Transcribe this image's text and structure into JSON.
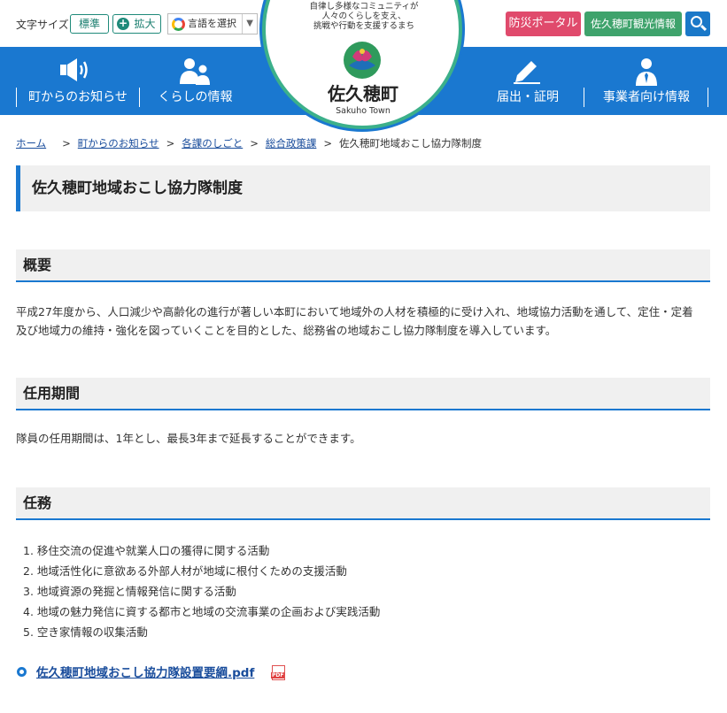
{
  "utility": {
    "font_size_label": "文字サイズ",
    "font_standard": "標準",
    "font_large": "拡大",
    "language_select": "言語を選択",
    "disaster_portal": "防災ポータル",
    "tourism_info": "佐久穂町観光情報"
  },
  "logo": {
    "tagline_1": "自律し多様なコミュニティが",
    "tagline_2": "人々のくらしを支え、",
    "tagline_3": "挑戦や行動を支援するまち",
    "name": "佐久穂町",
    "sub": "Sakuho Town"
  },
  "nav": {
    "items": [
      {
        "label": "町からのお知らせ",
        "icon": "megaphone-icon"
      },
      {
        "label": "くらしの情報",
        "icon": "people-icon"
      },
      {
        "label": "届出・証明",
        "icon": "pen-icon"
      },
      {
        "label": "事業者向け情報",
        "icon": "businessperson-icon"
      }
    ]
  },
  "breadcrumb": {
    "items": [
      "ホーム",
      "町からのお知らせ",
      "各課のしごと",
      "総合政策課"
    ],
    "current": "佐久穂町地域おこし協力隊制度"
  },
  "page_title": "佐久穂町地域おこし協力隊制度",
  "sections": {
    "overview": {
      "heading": "概要",
      "line_1": "平成27年度から、人口減少や高齢化の進行が著しい本町において地域外の人材を積極的に受け入れ、地域協力活動を通して、定住・定着",
      "line_2": "及び地域力の維持・強化を図っていくことを目的とした、総務省の地域おこし協力隊制度を導入しています。"
    },
    "term": {
      "heading": "任用期間",
      "text": "隊員の任用期間は、1年とし、最長3年まで延長することができます。"
    },
    "duties": {
      "heading": "任務",
      "items": [
        "1. 移住交流の促進や就業人口の獲得に関する活動",
        "2. 地域活性化に意欲ある外部人材が地域に根付くための支援活動",
        "3. 地域資源の発掘と情報発信に関する活動",
        "4. 地域の魅力発信に資する都市と地域の交流事業の企画および実践活動",
        "5. 空き家情報の収集活動"
      ]
    }
  },
  "download": {
    "label": "佐久穂町地域おこし協力隊設置要綱.pdf",
    "icon": "pdf-icon",
    "icon_text": "PDF"
  },
  "colors": {
    "nav_blue": "#1a78d0",
    "disaster_red": "#e04a6c",
    "tourism_green": "#3fa36c",
    "logo_ring": "#3cb08a"
  }
}
